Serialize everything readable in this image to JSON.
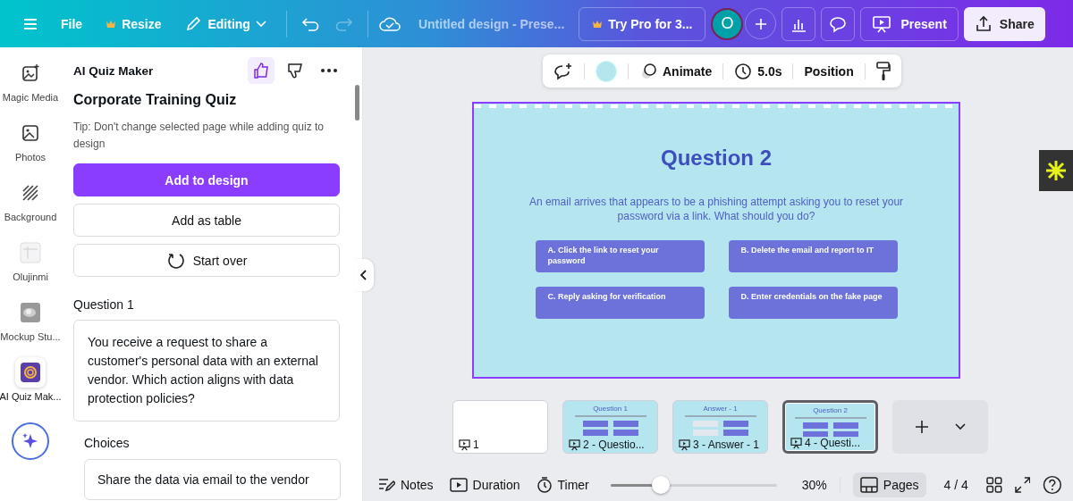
{
  "topbar": {
    "file": "File",
    "resize": "Resize",
    "mode": "Editing",
    "title": "Untitled design - Prese...",
    "pro": "Try Pro for 3...",
    "avatar": "O",
    "present": "Present",
    "share": "Share"
  },
  "history": [
    {
      "kind": "undo",
      "disabled": false
    },
    {
      "kind": "redo",
      "disabled": true
    }
  ],
  "rail": [
    {
      "kind": "magic",
      "label": "Magic Media",
      "selected": false
    },
    {
      "kind": "photos",
      "label": "Photos",
      "selected": false
    },
    {
      "kind": "background",
      "label": "Background",
      "selected": false
    },
    {
      "kind": "app",
      "label": "Olujinmi",
      "selected": false
    },
    {
      "kind": "mockup",
      "label": "Mockup Stu...",
      "selected": false
    },
    {
      "kind": "quiz",
      "label": "AI Quiz Mak...",
      "selected": true
    }
  ],
  "panel": {
    "title": "AI Quiz Maker",
    "liked": true,
    "quiz_title": "Corporate Training Quiz",
    "tip": "Tip: Don't change selected page while adding quiz to design",
    "buttons": [
      {
        "kind": "primary",
        "label": "Add to design"
      },
      {
        "kind": "plain",
        "label": "Add as table"
      },
      {
        "kind": "restart",
        "label": "Start over"
      }
    ],
    "question_label": "Question 1",
    "question_text": "You receive a request to share a customer's personal data with an external vendor. Which action aligns with data protection policies?",
    "choices_label": "Choices",
    "choice": "Share the data via email to the vendor"
  },
  "toolbar": {
    "color": "#b5e5ef",
    "animate": "Animate",
    "duration": "5.0s",
    "position": "Position"
  },
  "slide": {
    "title": "Question 2",
    "body": "An email arrives that appears to be a phishing attempt asking you to reset your password via a link. What should you do?",
    "options": [
      "A. Click the link to reset your password",
      "B. Delete the email and report to IT",
      "C. Reply asking for verification",
      "D. Enter credentials on the fake page"
    ]
  },
  "pages": [
    {
      "kind": "blank",
      "label": "1",
      "selected": false
    },
    {
      "kind": "quiz",
      "label": "2 - Questio...",
      "title": "Question 1",
      "selected": false
    },
    {
      "kind": "answer",
      "label": "3 - Answer - 1",
      "title": "Answer - 1",
      "selected": false
    },
    {
      "kind": "quiz",
      "label": "4 - Questi...",
      "title": "Question 2",
      "selected": true
    }
  ],
  "footer": {
    "notes": "Notes",
    "duration": "Duration",
    "timer": "Timer",
    "zoom": {
      "level": 0.3,
      "reading": "30%"
    },
    "pages": "Pages",
    "pages_selected": true,
    "count": "4 / 4"
  }
}
